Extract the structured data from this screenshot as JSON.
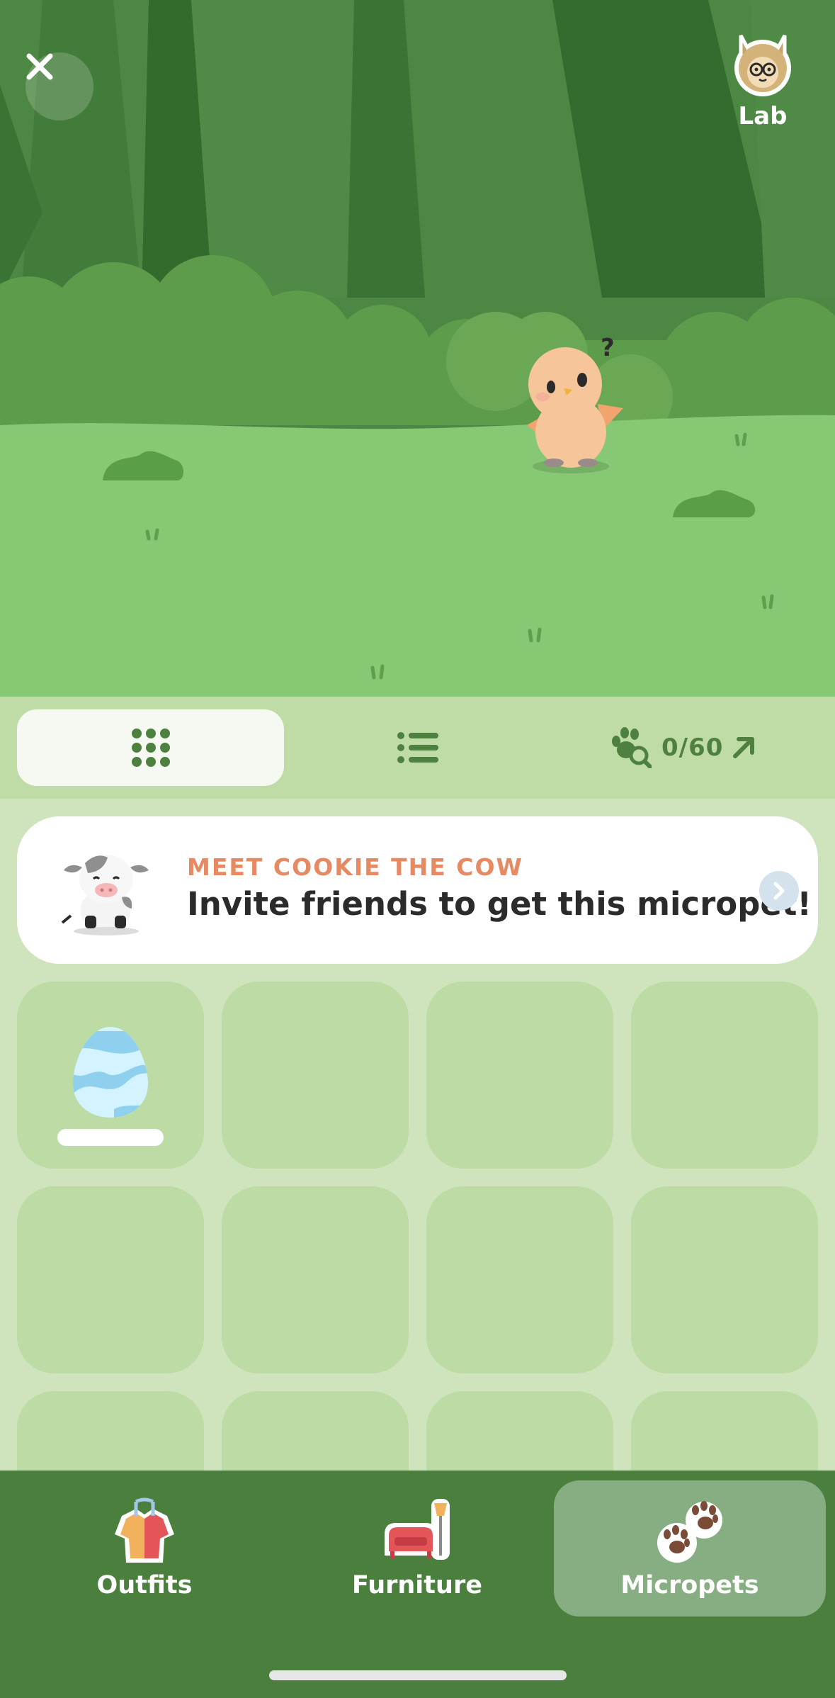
{
  "header": {
    "close_icon": "close-icon",
    "lab_label": "Lab",
    "lab_icon": "lab-avatar-icon"
  },
  "toolbar": {
    "grid_view_icon": "grid-icon",
    "list_view_icon": "list-icon",
    "collection_icon": "paw-search-icon",
    "collection_count": "0/60",
    "collection_arrow_icon": "arrow-up-right-icon",
    "active_view": "grid"
  },
  "promo": {
    "title": "MEET COOKIE THE COW",
    "subtitle": "Invite friends to get this micropet!",
    "image_icon": "cow-icon",
    "arrow_icon": "chevron-right-icon"
  },
  "slots": {
    "first_item_icon": "egg-icon",
    "visible_rows": 3,
    "columns": 4
  },
  "nav": {
    "items": [
      {
        "label": "Outfits",
        "icon": "outfit-icon",
        "active": false
      },
      {
        "label": "Furniture",
        "icon": "furniture-icon",
        "active": false
      },
      {
        "label": "Micropets",
        "icon": "paws-icon",
        "active": true
      }
    ]
  },
  "colors": {
    "scene_grass": "#86c873",
    "forest_dark": "#3c7335",
    "toolbar_bg": "#bfdca6",
    "content_bg": "#cfe4bd",
    "slot_bg": "#bddba4",
    "promo_title": "#e58a63",
    "nav_bg": "#4a7f3e",
    "nav_active": "#87ad82"
  }
}
